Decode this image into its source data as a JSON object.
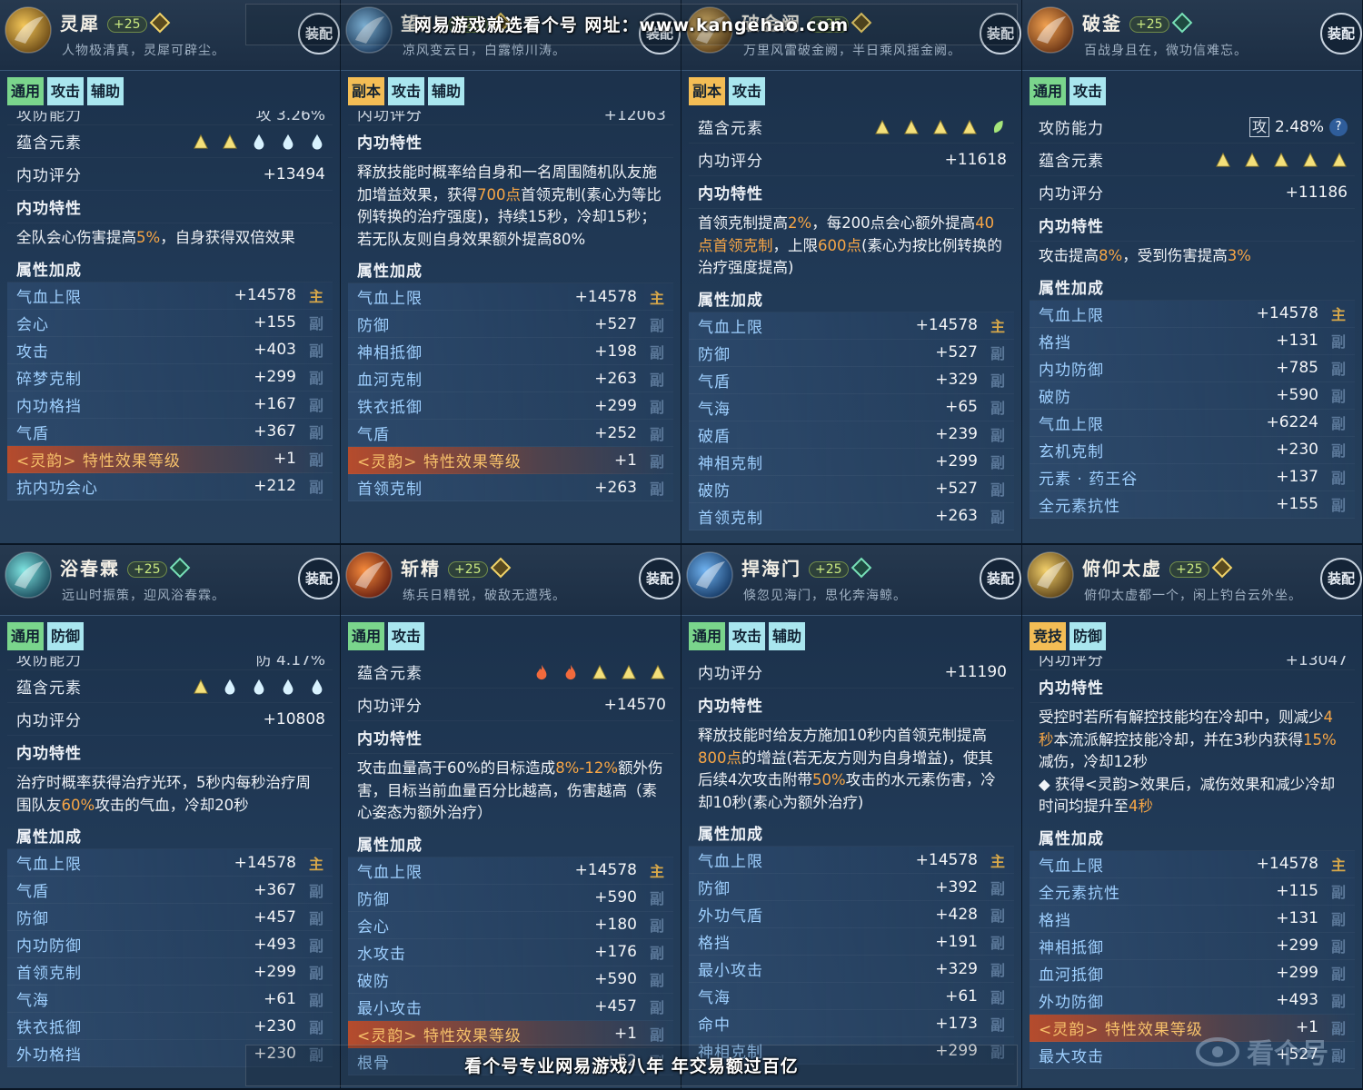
{
  "labels": {
    "element": "蕴含元素",
    "score": "内功评分",
    "trait": "内功特性",
    "attrs": "属性加成",
    "atkdef": "攻防能力"
  },
  "watermarks": {
    "top": "网易游戏就选看个号  网址：www.kangehao.com",
    "bottom": "看个号专业网易游戏八年  年交易额过百亿",
    "logo": "看个号"
  },
  "colors": {
    "panel_bg": "#213a57",
    "tag_green": "#7ad58c",
    "tag_cyan": "#a9e6ef",
    "tag_orange": "#f3bd55",
    "highlight": "#f7a646",
    "main_stat": "#d8a84a"
  },
  "cards": [
    {
      "name": "灵犀",
      "level": "+25",
      "motto": "人物极清真，灵犀可辟尘。",
      "equip_label": "装配",
      "icon": "golden-wing-icon",
      "icon_colors": [
        "#f3c658",
        "#6b4a16"
      ],
      "gem": "gold",
      "tags": [
        {
          "label": "通用",
          "style": "green"
        },
        {
          "label": "攻击",
          "style": "cyan"
        },
        {
          "label": "辅助",
          "style": "cyan"
        }
      ],
      "cut_top": {
        "label": "攻防能力",
        "value": "攻 3.26%"
      },
      "elements": [
        "mountain",
        "mountain",
        "water",
        "water",
        "water"
      ],
      "score": "+13494",
      "trait_html": "全队会心伤害提高<span class='hl'>5%</span>，自身获得双倍效果",
      "attrs_title": "属性加成",
      "attrs": [
        {
          "label": "气血上限",
          "value": "+14578",
          "src": "主"
        },
        {
          "label": "会心",
          "value": "+155",
          "src": "副"
        },
        {
          "label": "攻击",
          "value": "+403",
          "src": "副"
        },
        {
          "label": "碎梦克制",
          "value": "+299",
          "src": "副"
        },
        {
          "label": "内功格挡",
          "value": "+167",
          "src": "副"
        },
        {
          "label": "气盾",
          "value": "+367",
          "src": "副"
        },
        {
          "label": "<灵韵> 特性效果等级",
          "value": "+1",
          "src": "副",
          "special": true
        },
        {
          "label": "抗内功会心",
          "value": "+212",
          "src": "副"
        }
      ]
    },
    {
      "name": "望川",
      "level": "+25",
      "motto": "凉风变云日，白露惊川涛。",
      "equip_label": "装配",
      "icon": "blue-sword-icon",
      "icon_colors": [
        "#8fc8f0",
        "#1c3a5c"
      ],
      "gem": "gold",
      "tags": [
        {
          "label": "副本",
          "style": "orange"
        },
        {
          "label": "攻击",
          "style": "cyan"
        },
        {
          "label": "辅助",
          "style": "cyan"
        }
      ],
      "cut_top": {
        "label": "内功评分",
        "value": "+12063"
      },
      "elements": [],
      "score": null,
      "trait_html": "释放技能时概率给自身和一名周围随机队友施加增益效果，获得<span class='hl'>700点</span>首领克制(素心为等比例转换的治疗强度)，持续15秒，冷却15秒；若无队友则自身效果额外提高80%",
      "attrs_title": "属性加成",
      "attrs": [
        {
          "label": "气血上限",
          "value": "+14578",
          "src": "主"
        },
        {
          "label": "防御",
          "value": "+527",
          "src": "副"
        },
        {
          "label": "神相抵御",
          "value": "+198",
          "src": "副"
        },
        {
          "label": "血河克制",
          "value": "+263",
          "src": "副"
        },
        {
          "label": "铁衣抵御",
          "value": "+299",
          "src": "副"
        },
        {
          "label": "气盾",
          "value": "+252",
          "src": "副"
        },
        {
          "label": "<灵韵> 特性效果等级",
          "value": "+1",
          "src": "副",
          "special": true
        },
        {
          "label": "首领克制",
          "value": "+263",
          "src": "副"
        }
      ]
    },
    {
      "name": "破金阙",
      "level": "+25",
      "motto": "万里风雷破金阙，半日乘风摇金阙。",
      "equip_label": "装配",
      "icon": "golden-blade-icon",
      "icon_colors": [
        "#e8c070",
        "#5a3e18"
      ],
      "gem": "gold",
      "tags": [
        {
          "label": "副本",
          "style": "orange"
        },
        {
          "label": "攻击",
          "style": "cyan"
        }
      ],
      "cut_top": null,
      "elements": [
        "mountain",
        "mountain",
        "mountain",
        "mountain",
        "leaf"
      ],
      "score": "+11618",
      "trait_html": "首领克制提高<span class='hl'>2%</span>，每200点会心额外提高<span class='hl'>40点首领克制</span>，上限<span class='hl'>600点</span>(素心为按比例转换的治疗强度提高)",
      "attrs_title": "属性加成",
      "attrs": [
        {
          "label": "气血上限",
          "value": "+14578",
          "src": "主"
        },
        {
          "label": "防御",
          "value": "+527",
          "src": "副"
        },
        {
          "label": "气盾",
          "value": "+329",
          "src": "副"
        },
        {
          "label": "气海",
          "value": "+65",
          "src": "副"
        },
        {
          "label": "破盾",
          "value": "+239",
          "src": "副"
        },
        {
          "label": "神相克制",
          "value": "+299",
          "src": "副"
        },
        {
          "label": "破防",
          "value": "+527",
          "src": "副"
        },
        {
          "label": "首领克制",
          "value": "+263",
          "src": "副"
        }
      ]
    },
    {
      "name": "破釜",
      "level": "+25",
      "motto": "百战身且在，微功信难忘。",
      "equip_label": "装配",
      "icon": "fire-cauldron-icon",
      "icon_colors": [
        "#f0a050",
        "#6a3414"
      ],
      "gem": "green",
      "tags": [
        {
          "label": "通用",
          "style": "green"
        },
        {
          "label": "攻击",
          "style": "cyan"
        }
      ],
      "cut_top": null,
      "atkdef": {
        "label": "攻防能力",
        "box": "攻",
        "value": "2.48%",
        "q": "?"
      },
      "elements": [
        "mountain",
        "mountain",
        "mountain",
        "mountain",
        "mountain"
      ],
      "score": "+11186",
      "trait_html": "攻击提高<span class='hl'>8%</span>，受到伤害提高<span class='hl'>3%</span>",
      "attrs_title": "属性加成",
      "attrs": [
        {
          "label": "气血上限",
          "value": "+14578",
          "src": "主"
        },
        {
          "label": "格挡",
          "value": "+131",
          "src": "副"
        },
        {
          "label": "内功防御",
          "value": "+785",
          "src": "副"
        },
        {
          "label": "破防",
          "value": "+590",
          "src": "副"
        },
        {
          "label": "气血上限",
          "value": "+6224",
          "src": "副"
        },
        {
          "label": "玄机克制",
          "value": "+230",
          "src": "副"
        },
        {
          "label": "元素 · 药王谷",
          "value": "+137",
          "src": "副"
        },
        {
          "label": "全元素抗性",
          "value": "+155",
          "src": "副"
        }
      ]
    },
    {
      "name": "浴春霖",
      "level": "+25",
      "motto": "远山时振策，迎风浴春霖。",
      "equip_label": "装配",
      "icon": "spring-swirl-icon",
      "icon_colors": [
        "#7ee3e0",
        "#1b4d5e"
      ],
      "gem": "green",
      "tags": [
        {
          "label": "通用",
          "style": "green"
        },
        {
          "label": "防御",
          "style": "cyan"
        }
      ],
      "cut_top": {
        "label": "攻防能力",
        "value": "防 4.17%"
      },
      "elements": [
        "mountain",
        "water",
        "water",
        "water",
        "water"
      ],
      "score": "+10808",
      "trait_html": "治疗时概率获得治疗光环，5秒内每秒治疗周围队友<span class='hl'>60%</span>攻击的气血，冷却20秒",
      "attrs_title": "属性加成",
      "attrs": [
        {
          "label": "气血上限",
          "value": "+14578",
          "src": "主"
        },
        {
          "label": "气盾",
          "value": "+367",
          "src": "副"
        },
        {
          "label": "防御",
          "value": "+457",
          "src": "副"
        },
        {
          "label": "内功防御",
          "value": "+493",
          "src": "副"
        },
        {
          "label": "首领克制",
          "value": "+299",
          "src": "副"
        },
        {
          "label": "气海",
          "value": "+61",
          "src": "副"
        },
        {
          "label": "铁衣抵御",
          "value": "+230",
          "src": "副"
        },
        {
          "label": "外功格挡",
          "value": "+230",
          "src": "副"
        }
      ]
    },
    {
      "name": "斩精",
      "level": "+25",
      "motto": "练兵日精锐，破敌无遗残。",
      "equip_label": "装配",
      "icon": "flame-blade-icon",
      "icon_colors": [
        "#f58a3c",
        "#6a2010"
      ],
      "gem": "gold",
      "tags": [
        {
          "label": "通用",
          "style": "green"
        },
        {
          "label": "攻击",
          "style": "cyan"
        }
      ],
      "cut_top": null,
      "elements": [
        "fire",
        "fire",
        "mountain",
        "mountain",
        "mountain"
      ],
      "score": "+14570",
      "trait_html": "攻击血量高于60%的目标造成<span class='hl'>8%-12%</span>额外伤害，目标当前血量百分比越高，伤害越高（素心姿态为额外治疗）",
      "attrs_title": "属性加成",
      "attrs": [
        {
          "label": "气血上限",
          "value": "+14578",
          "src": "主"
        },
        {
          "label": "防御",
          "value": "+590",
          "src": "副"
        },
        {
          "label": "会心",
          "value": "+180",
          "src": "副"
        },
        {
          "label": "水攻击",
          "value": "+176",
          "src": "副"
        },
        {
          "label": "破防",
          "value": "+590",
          "src": "副"
        },
        {
          "label": "最小攻击",
          "value": "+457",
          "src": "副"
        },
        {
          "label": "<灵韵> 特性效果等级",
          "value": "+1",
          "src": "副",
          "special": true
        },
        {
          "label": "根骨",
          "value": "+52",
          "src": "副"
        }
      ]
    },
    {
      "name": "捍海门",
      "level": "+25",
      "motto": "倏忽见海门，思化奔海鲸。",
      "equip_label": "装配",
      "icon": "wave-gate-icon",
      "icon_colors": [
        "#6fb2f0",
        "#163a66"
      ],
      "gem": "green",
      "tags": [
        {
          "label": "通用",
          "style": "green"
        },
        {
          "label": "攻击",
          "style": "cyan"
        },
        {
          "label": "辅助",
          "style": "cyan"
        }
      ],
      "cut_top": null,
      "elements": [],
      "score": "+11190",
      "trait_html": "释放技能时给友方施加10秒内首领克制提高<span class='hl'>800点</span>的增益(若无友方则为自身增益)，使其后续4次攻击附带<span class='hl'>50%</span>攻击的水元素伤害，冷却10秒(素心为额外治疗)",
      "attrs_title": "属性加成",
      "attrs": [
        {
          "label": "气血上限",
          "value": "+14578",
          "src": "主"
        },
        {
          "label": "防御",
          "value": "+392",
          "src": "副"
        },
        {
          "label": "外功气盾",
          "value": "+428",
          "src": "副"
        },
        {
          "label": "格挡",
          "value": "+191",
          "src": "副"
        },
        {
          "label": "最小攻击",
          "value": "+329",
          "src": "副"
        },
        {
          "label": "气海",
          "value": "+61",
          "src": "副"
        },
        {
          "label": "命中",
          "value": "+173",
          "src": "副"
        },
        {
          "label": "神相克制",
          "value": "+299",
          "src": "副"
        }
      ]
    },
    {
      "name": "俯仰太虚",
      "level": "+25",
      "motto": "俯仰太虚都一个，闲上钓台云外坐。",
      "equip_label": "装配",
      "icon": "golden-sun-icon",
      "icon_colors": [
        "#f2cf6a",
        "#5e4418"
      ],
      "gem": "gold",
      "tags": [
        {
          "label": "竞技",
          "style": "orange"
        },
        {
          "label": "防御",
          "style": "cyan"
        }
      ],
      "cut_top": {
        "label": "内功评分",
        "value": "+13047"
      },
      "elements": [],
      "score": null,
      "trait_html": "受控时若所有解控技能均在冷却中，则减少<span class='hl'>4秒</span>本流派解控技能冷却，并在3秒内获得<span class='hl'>15%</span>减伤，冷却12秒<br>◆ 获得<灵韵>效果后，减伤效果和减少冷却时间均提升至<span class='hl'>4秒</span>",
      "attrs_title": "属性加成",
      "attrs": [
        {
          "label": "气血上限",
          "value": "+14578",
          "src": "主"
        },
        {
          "label": "全元素抗性",
          "value": "+115",
          "src": "副"
        },
        {
          "label": "格挡",
          "value": "+131",
          "src": "副"
        },
        {
          "label": "神相抵御",
          "value": "+299",
          "src": "副"
        },
        {
          "label": "血河抵御",
          "value": "+299",
          "src": "副"
        },
        {
          "label": "外功防御",
          "value": "+493",
          "src": "副"
        },
        {
          "label": "<灵韵> 特性效果等级",
          "value": "+1",
          "src": "副",
          "special": true
        },
        {
          "label": "最大攻击",
          "value": "+527",
          "src": "副"
        }
      ]
    }
  ]
}
